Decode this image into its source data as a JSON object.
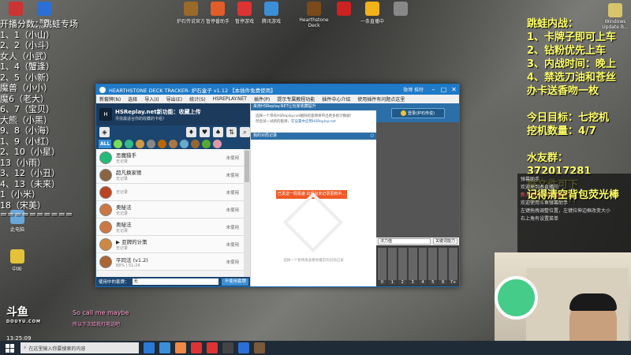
{
  "desktop": {
    "top_icons": [
      {
        "label": "",
        "color": "#c33"
      },
      {
        "label": "新建Microsoft...",
        "color": "#2a6fd6"
      },
      {
        "label": "炉石传说官方",
        "color": "#9a6a2a"
      },
      {
        "label": "暂停番助手",
        "color": "#e35d2a"
      },
      {
        "label": "暂停游戏",
        "color": "#d33"
      },
      {
        "label": "腾讯游戏",
        "color": "#3b8fd6"
      },
      {
        "label": "Hearthstone Deck",
        "color": "#7a4a1a"
      },
      {
        "label": "",
        "color": "#c22"
      },
      {
        "label": "一条直播中",
        "color": "#f2b21a"
      },
      {
        "label": "",
        "color": "#888"
      }
    ],
    "right_icon": {
      "label": "Windows Update B...",
      "color": "#d8c46a"
    },
    "left_icons": [
      {
        "label": "此电脑",
        "color": "#6aa6d8"
      },
      {
        "label": "",
        "color": "#333"
      },
      {
        "label": "中国·",
        "color": "#e3c23a"
      }
    ]
  },
  "left_overlay": {
    "lines": [
      "开播分数：跳蛙专场",
      "1、1（小山）",
      "2、2（小斗）",
      "女人（小武）",
      "1、4（蟹逢）",
      "2、5（小新）",
      "魔兽（小小）",
      "魔6（老大）",
      "6、7（宝贝）",
      "大熊（小黑）",
      "9、8（小海）",
      "1、9（小红）",
      "2、10（小星）",
      "13（小雨）",
      "3、12（小丑）",
      "4、13（未来）",
      "1（小米）",
      "18（宋美）",
      "=========="
    ]
  },
  "right_overlay": {
    "lines_a": [
      "跳蛙内战：",
      "1、卡牌子即可上车",
      "2、钻粉优先上车",
      "3、内战时间：晚上",
      "4、禁选刀油和苍丝",
      "办卡送香吻一枚"
    ],
    "lines_b": [
      "今日目标：七挖机",
      "挖机数量：4/7"
    ],
    "lines_c": [
      "水友群：372017281",
      "群文件可下",
      "载技线插件"
    ],
    "remember": "记得清空背包荧光棒"
  },
  "chat": {
    "rows": [
      {
        "text": "弹幕助手",
        "highlight": false
      },
      {
        "text": "欢迎来到本直播间",
        "highlight": false
      },
      {
        "text": "新人 欢迎来到本直播间",
        "highlight": true
      },
      {
        "text": "欢迎使用斗鱼弹幕助手",
        "highlight": false
      },
      {
        "text": "左键拖拽调整位置，左键拉伸边框改变大小",
        "highlight": false
      },
      {
        "text": "右上角有设置菜单",
        "highlight": false
      }
    ]
  },
  "stream": {
    "logo": "斗鱼",
    "logo_sub": "DOUYU.COM",
    "song": "So call me maybe",
    "song_sub": "所以下次给我打电话吧",
    "clock": "13:25:09"
  },
  "taskbar": {
    "search_placeholder": "在这里输入你要搜索的内容",
    "apps": [
      "#2b7ad6",
      "#3b8fd6",
      "#e84",
      "#d33",
      "#d33",
      "#444",
      "#2a6fd6",
      "#7a5a3a"
    ]
  },
  "window": {
    "title": "HEARTHSTONE DECK TRACKER- 炉石盒子 v1.12 【本插件免费使用】",
    "social": "微博  推特",
    "menu": [
      "新套牌(N)",
      "选择",
      "导入(I)",
      "导出(E)",
      "统计(S)",
      "HSREPLAY.NET",
      "插件(P)",
      "提示专属教程功能",
      "插件中心介绍",
      "使用插件有问题点这里"
    ],
    "deck_panel": {
      "banner_title": "HSReplay.net新功能：收藏上传",
      "banner_sub": "寻找最适合你的收藏的卡组！",
      "filter_icons": [
        "♦",
        "♥",
        "♠",
        "⇅",
        "⌕"
      ],
      "all_label": "ALL",
      "class_colors": [
        "#7d5",
        "#3b8",
        "#c94",
        "#888",
        "#b60",
        "#a74",
        "#6ac",
        "#963",
        "#5a3",
        "#d9a"
      ],
      "decks": [
        {
          "name": "恶魔猎手",
          "sub": "无记录",
          "status": "未使用",
          "color": "#2b7"
        },
        {
          "name": "超凡换家德",
          "sub": "无记录",
          "status": "未使用",
          "color": "#864"
        },
        {
          "name": "",
          "sub": "无记录",
          "status": "未使用",
          "color": "#b42"
        },
        {
          "name": "奥秘法",
          "sub": "无记录",
          "status": "未使用",
          "color": "#c74"
        },
        {
          "name": "奥秘法",
          "sub": "无记录",
          "status": "未使用",
          "color": "#c74"
        },
        {
          "name": "▶ 亚牌的计策",
          "sub": "无记录",
          "status": "未使用",
          "color": "#c84"
        },
        {
          "name": "平同法 (v1.2)",
          "sub": "68% | 51-24",
          "status": "未使用",
          "color": "#a63"
        }
      ],
      "footer_label": "使用中的套牌：",
      "footer_value": "无",
      "footer_button": "不使用套牌"
    },
    "center_panel": {
      "promo_head": "来用HSReplay.NET让玩家收藏提升",
      "promo_text": "选择一个带有HSReplay.net删除的套牌将带出更多统计数据！",
      "promo_text2": "然后试一试新的套牌，",
      "promo_link": "在设置中启用HSReplay.net",
      "replay_head": "我的对局记录",
      "error_button": "已发送一局极速 出现尚未记录更新中...",
      "empty_msg": "选择一个套牌来查看你最近的对局记录"
    },
    "right_panel": {
      "login_button": "登录(炉石传说)",
      "mana_label": "法力值",
      "mana_button": "关键词能力",
      "curve_labels": [
        "0",
        "1",
        "2",
        "3",
        "4",
        "5",
        "6",
        "7+"
      ]
    }
  }
}
